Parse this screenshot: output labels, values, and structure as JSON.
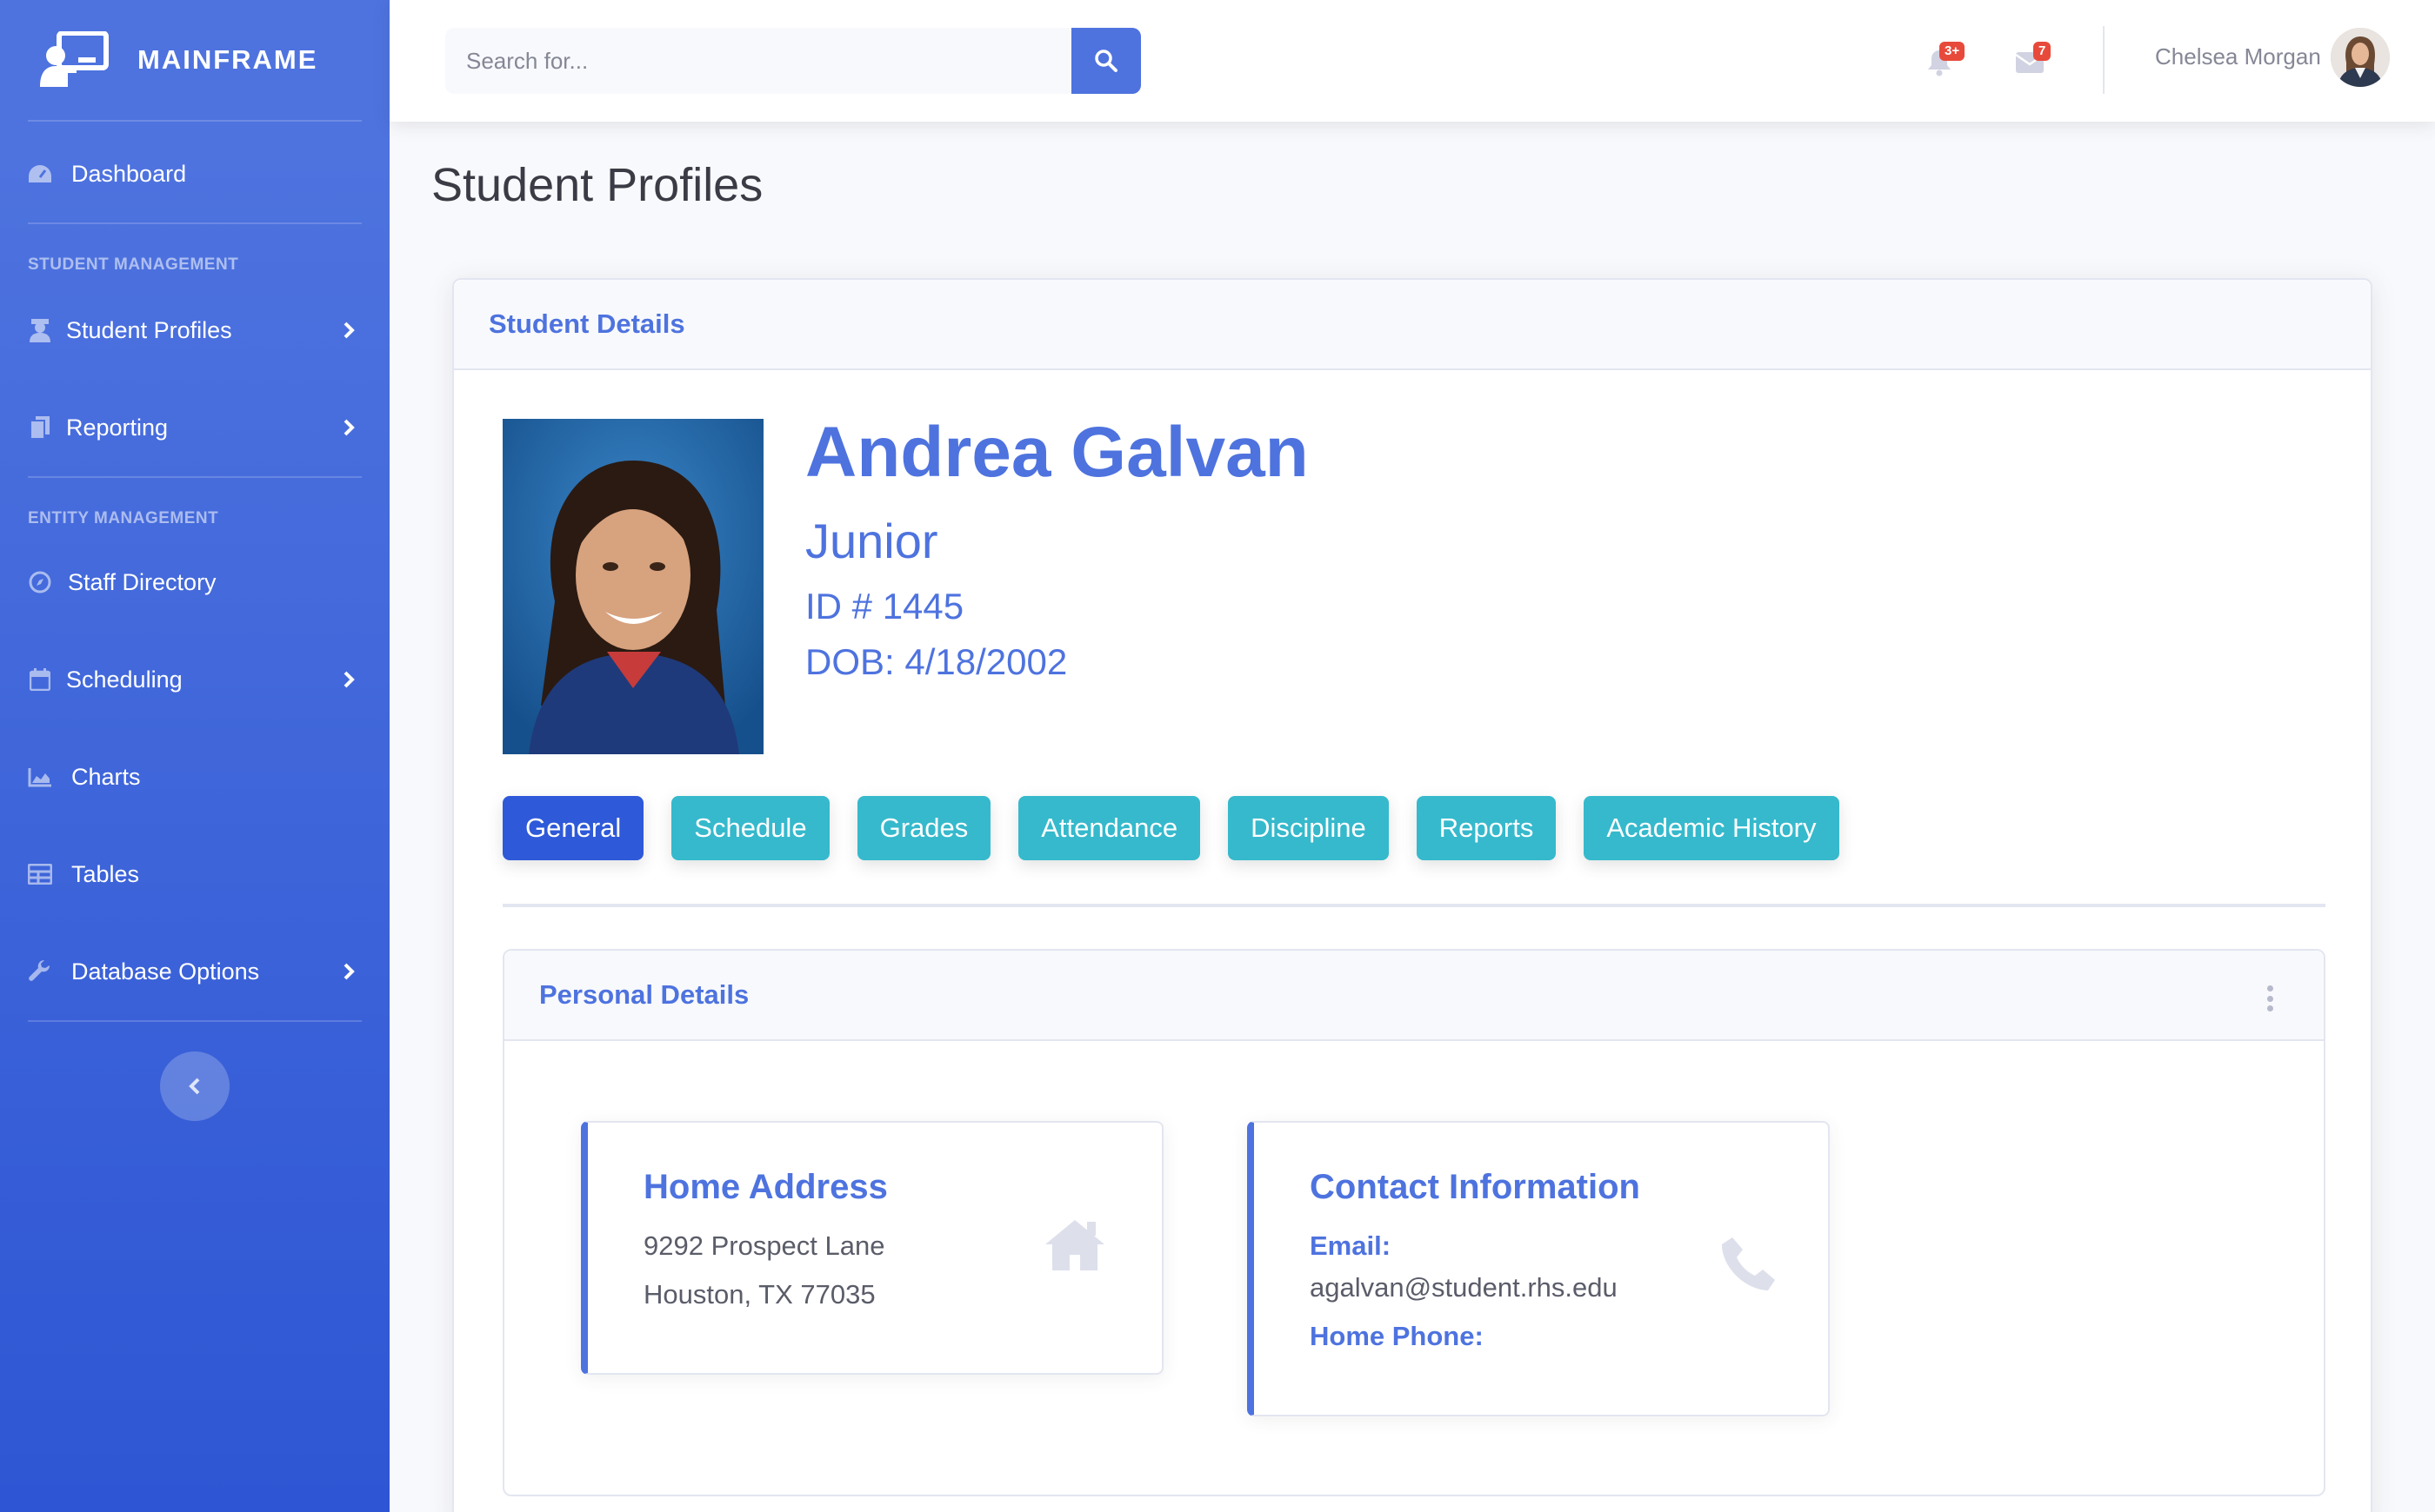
{
  "brand": {
    "name": "MAINFRAME"
  },
  "sidebar": {
    "items": [
      {
        "label": "Dashboard",
        "icon": "tachometer-icon",
        "has_chevron": false
      },
      {
        "heading": "STUDENT MANAGEMENT"
      },
      {
        "label": "Student Profiles",
        "icon": "user-graduate-icon",
        "has_chevron": true
      },
      {
        "label": "Reporting",
        "icon": "copy-icon",
        "has_chevron": true
      },
      {
        "heading": "ENTITY MANAGEMENT"
      },
      {
        "label": "Staff Directory",
        "icon": "compass-icon",
        "has_chevron": false
      },
      {
        "label": "Scheduling",
        "icon": "calendar-icon",
        "has_chevron": true
      },
      {
        "label": "Charts",
        "icon": "area-chart-icon",
        "has_chevron": false
      },
      {
        "label": "Tables",
        "icon": "table-icon",
        "has_chevron": false
      },
      {
        "label": "Database Options",
        "icon": "wrench-icon",
        "has_chevron": true
      }
    ]
  },
  "topbar": {
    "search_placeholder": "Search for...",
    "alerts_badge": "3+",
    "messages_badge": "7",
    "user_name": "Chelsea Morgan"
  },
  "page": {
    "title": "Student Profiles"
  },
  "student_card": {
    "header": "Student Details"
  },
  "student": {
    "name": "Andrea Galvan",
    "grade": "Junior",
    "id_text": "ID # 1445",
    "dob_text": "DOB: 4/18/2002"
  },
  "tabs": [
    {
      "label": "General",
      "active": true
    },
    {
      "label": "Schedule",
      "active": false
    },
    {
      "label": "Grades",
      "active": false
    },
    {
      "label": "Attendance",
      "active": false
    },
    {
      "label": "Discipline",
      "active": false
    },
    {
      "label": "Reports",
      "active": false
    },
    {
      "label": "Academic History",
      "active": false
    }
  ],
  "personal": {
    "header": "Personal Details",
    "address": {
      "title": "Home Address",
      "line1": "9292 Prospect Lane",
      "line2": "Houston, TX 77035"
    },
    "contact": {
      "title": "Contact Information",
      "email_label": "Email:",
      "email": "agalvan@student.rhs.edu",
      "phone_label": "Home Phone:"
    }
  },
  "colors": {
    "primary": "#4e73df",
    "info": "#36b9cc",
    "danger": "#e74a3b",
    "active_tab": "#2e59d9"
  }
}
